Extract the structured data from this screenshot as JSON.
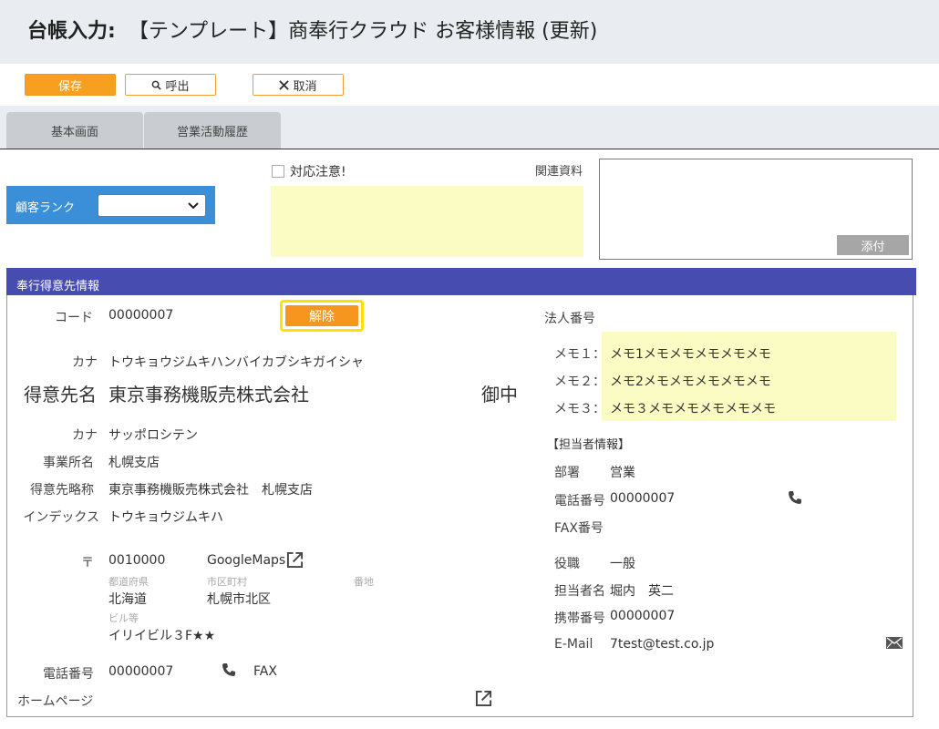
{
  "header": {
    "prefix": "台帳入力:",
    "title": "【テンプレート】商奉行クラウド お客様情報 (更新)"
  },
  "toolbar": {
    "save": "保存",
    "call": "呼出",
    "cancel": "取消"
  },
  "tabs": [
    {
      "label": "基本画面"
    },
    {
      "label": "営業活動履歴"
    }
  ],
  "rank": {
    "label": "顧客ランク",
    "value": ""
  },
  "caution": {
    "label": "対応注意!"
  },
  "related": {
    "label": "関連資料",
    "attach": "添付"
  },
  "section": {
    "title": "奉行得意先情報"
  },
  "customer": {
    "code_label": "コード",
    "code": "00000007",
    "release": "解除",
    "kana_label": "カナ",
    "kana": "トウキョウジムキハンバイカブシキガイシャ",
    "name_label": "得意先名",
    "name": "東京事務機販売株式会社",
    "honorific": "御中",
    "branch_kana_label": "カナ",
    "branch_kana": "サッポロシテン",
    "branch_label": "事業所名",
    "branch": "札幌支店",
    "short_label": "得意先略称",
    "short": "東京事務機販売株式会社　札幌支店",
    "index_label": "インデックス",
    "index": "トウキョウジムキハ",
    "postal_label": "〒",
    "postal": "0010000",
    "maps": "GoogleMaps",
    "pref_label": "都道府県",
    "pref": "北海道",
    "city_label": "市区町村",
    "city": "札幌市北区",
    "addr_label": "番地",
    "bldg_label": "ビル等",
    "bldg": "イリイビル３F★★",
    "phone_label": "電話番号",
    "phone": "00000007",
    "fax_label": "FAX",
    "homepage_label": "ホームページ"
  },
  "right": {
    "corp_label": "法人番号",
    "memo1_label": "メモ１：",
    "memo1": "メモ1メモメモメモメモメモ",
    "memo2_label": "メモ２：",
    "memo2": "メモ2メモメモメモメモメモ",
    "memo3_label": "メモ３：",
    "memo3": "メモ３メモメモメモメモメモ",
    "staff_header": "【担当者情報】",
    "dept_label": "部署",
    "dept": "営業",
    "tel_label": "電話番号",
    "tel": "00000007",
    "fax_label": "FAX番号",
    "role_label": "役職",
    "role": "一般",
    "person_label": "担当者名",
    "person": "堀内　英二",
    "mobile_label": "携帯番号",
    "mobile": "00000007",
    "email_label": "E-Mail",
    "email": "7test@test.co.jp"
  }
}
